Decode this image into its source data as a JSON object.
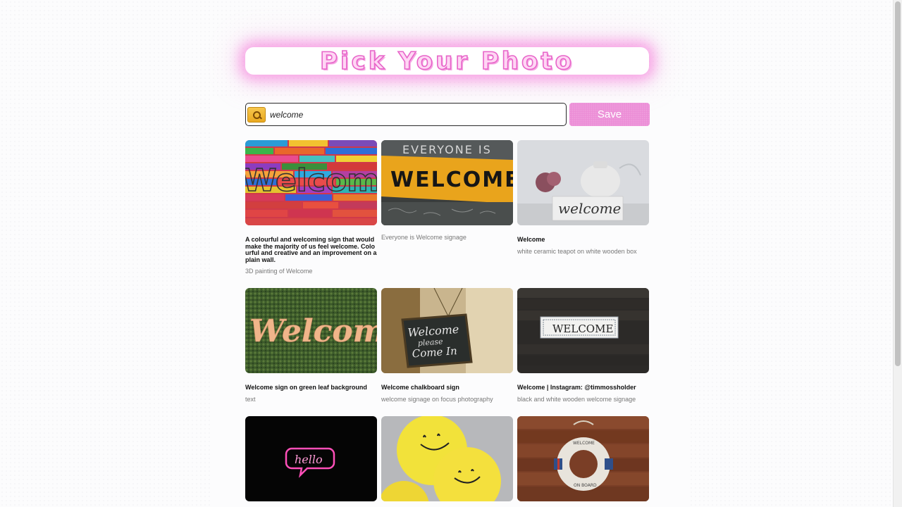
{
  "header": {
    "title": "Pick Your Photo"
  },
  "search": {
    "value": "welcome",
    "placeholder": ""
  },
  "toolbar": {
    "save_label": "Save"
  },
  "colors": {
    "accent": "#ec8fd7",
    "glow": "#f56ed7"
  },
  "photos": [
    {
      "title": "A colourful and welcoming sign that would make the majority of us feel welcome. Colourful and creative and an improvement on a plain wall.",
      "description": "3D painting of Welcome"
    },
    {
      "title": "",
      "description": "Everyone is Welcome signage"
    },
    {
      "title": "Welcome",
      "description": "white ceramic teapot on white wooden box"
    },
    {
      "title": "Welcome sign on green leaf background",
      "description": "text"
    },
    {
      "title": "Welcome chalkboard sign",
      "description": "welcome signage on focus photography"
    },
    {
      "title": "Welcome | Instagram: @timmossholder",
      "description": "black and white wooden welcome signage"
    },
    {
      "title": "",
      "description": ""
    },
    {
      "title": "",
      "description": ""
    },
    {
      "title": "",
      "description": ""
    }
  ]
}
